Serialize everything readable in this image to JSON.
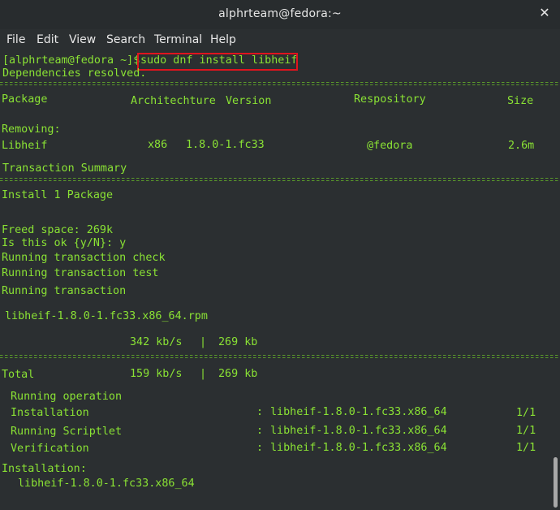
{
  "window": {
    "title": "alphrteam@fedora:~"
  },
  "menu": [
    "File",
    "Edit",
    "View",
    "Search",
    "Terminal",
    "Help"
  ],
  "prompt": "[alphrteam@fedora ~]$",
  "command": "sudo dnf install libheif",
  "lines": {
    "deps": "Dependencies resolved.",
    "removing": "Removing:",
    "txn_summary": "Transaction Summary",
    "install_pkg": "Install 1 Package",
    "freed": "Freed space: 269k",
    "is_ok": "Is this ok {y/N}: y",
    "check": "Running transaction check",
    "test": "Running transaction test",
    "running": "Running transaction",
    "rpm": "libheif-1.8.0-1.fc33.x86_64.rpm",
    "dl_speed": "342 kb/s",
    "dl_sep": "|",
    "dl_size": "269 kb",
    "total": "Total",
    "total_speed": "159 kb/s",
    "total_sep": "|",
    "total_size": "269 kb",
    "op": "Running operation",
    "installed_hdr": "Installation:",
    "installed_pkg": "libheif-1.8.0-1.fc33.x86_64"
  },
  "table": {
    "headers": {
      "package": "Package",
      "arch": "Architechture",
      "version": "Version",
      "repo": "Respository",
      "size": "Size"
    },
    "row": {
      "package": "Libheif",
      "arch": "x86",
      "version": "1.8.0-1.fc33",
      "repo": "@fedora",
      "size": "2.6m"
    }
  },
  "steps": [
    {
      "label": "Installation",
      "sep": ":",
      "pkg": "libheif-1.8.0-1.fc33.x86_64",
      "count": "1/1"
    },
    {
      "label": "Running Scriptlet",
      "sep": ":",
      "pkg": "libheif-1.8.0-1.fc33.x86_64",
      "count": "1/1"
    },
    {
      "label": "Verification",
      "sep": ":",
      "pkg": "libheif-1.8.0-1.fc33.x86_64",
      "count": "1/1"
    }
  ],
  "colors": {
    "text": "#8ae234",
    "background": "#2b2f31",
    "highlight": "#e0141e"
  },
  "icons": {
    "close": "close-icon"
  }
}
